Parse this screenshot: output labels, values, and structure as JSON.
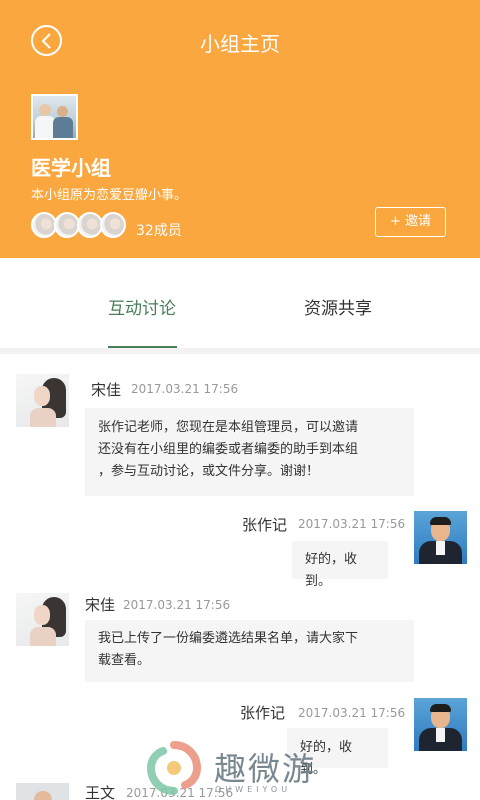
{
  "header": {
    "title": "小组主页",
    "group_name": "医学小组",
    "group_desc": "本小组原为恋爱豆瓣小事。",
    "member_count": "32成员",
    "invite_label": "+ 邀请"
  },
  "tabs": [
    {
      "label": "互动讨论",
      "active": true
    },
    {
      "label": "资源共享",
      "active": false
    }
  ],
  "messages": [
    {
      "name": "宋佳",
      "time": "2017.03.21 17:56",
      "side": "left",
      "avatar": "woman",
      "lines": [
        "张作记老师，您现在是本组管理员，可以邀请",
        "还没有在小组里的编委或者编委的助手到本组",
        "，参与互动讨论，或文件分享。谢谢！"
      ]
    },
    {
      "name": "张作记",
      "time": "2017.03.21 17:56",
      "side": "right",
      "avatar": "man",
      "lines": [
        "好的，收到。"
      ]
    },
    {
      "name": "宋佳",
      "time": "2017.03.21 17:56",
      "side": "left",
      "avatar": "woman",
      "lines": [
        "我已上传了一份编委遴选结果名单，请大家下",
        "载查看。"
      ]
    },
    {
      "name": "张作记",
      "time": "2017.03.21 17:56",
      "side": "right",
      "avatar": "man",
      "lines": [
        "好的，收到。"
      ]
    },
    {
      "name": "王文",
      "time": "2017.03.21 17:56",
      "side": "left",
      "avatar": "wang",
      "lines": []
    }
  ],
  "watermark": {
    "text": "趣微游",
    "sub": "QUWEIYOU"
  },
  "colors": {
    "accent": "#fba73f",
    "tab_active": "#4a7d5a"
  }
}
